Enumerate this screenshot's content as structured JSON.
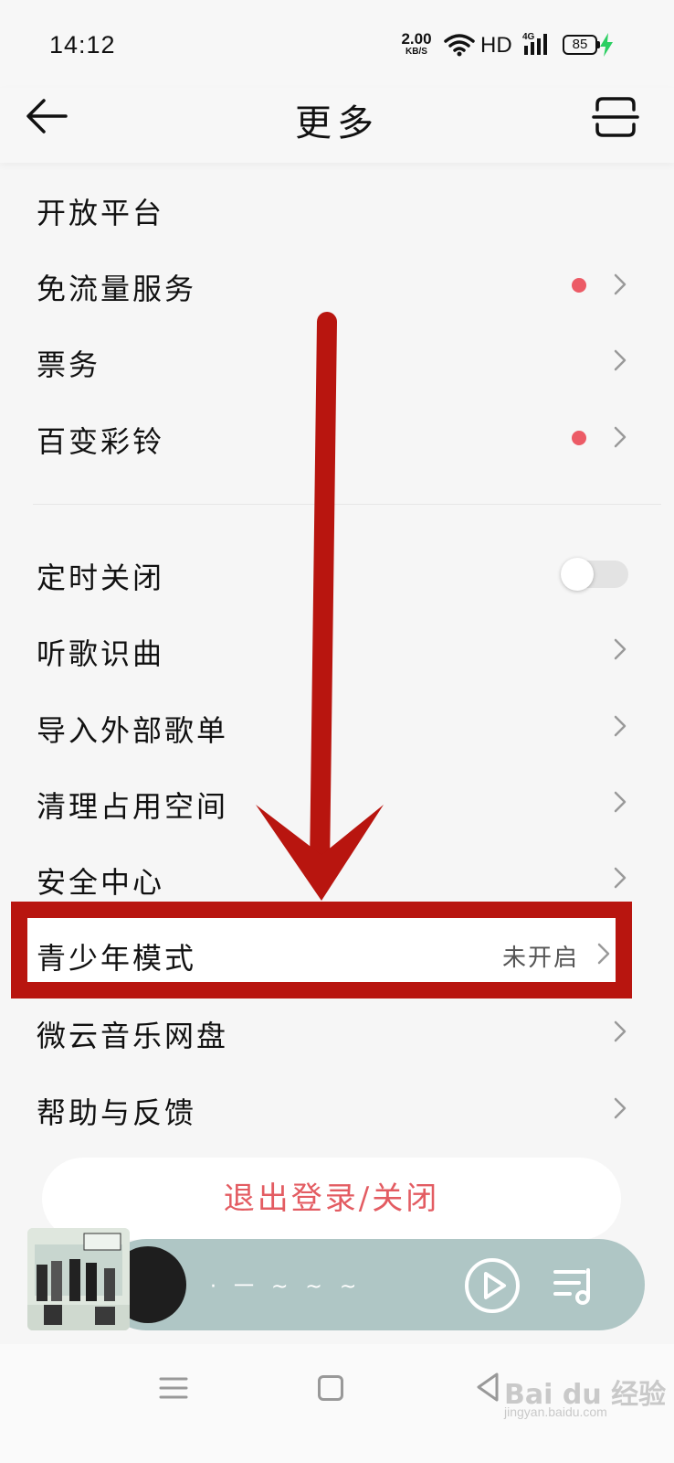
{
  "status": {
    "time": "14:12",
    "net_speed": "2.00",
    "net_unit": "KB/S",
    "hd": "HD",
    "network": "4G",
    "battery": "85"
  },
  "header": {
    "title": "更多"
  },
  "menu_group1": [
    {
      "label": "开放平台",
      "dot": false,
      "chevron": false
    },
    {
      "label": "免流量服务",
      "dot": true,
      "chevron": true
    },
    {
      "label": "票务",
      "dot": false,
      "chevron": true
    },
    {
      "label": "百变彩铃",
      "dot": true,
      "chevron": true
    }
  ],
  "menu_group2": [
    {
      "label": "定时关闭",
      "toggle": false
    },
    {
      "label": "听歌识曲"
    },
    {
      "label": "导入外部歌单"
    },
    {
      "label": "清理占用空间"
    },
    {
      "label": "安全中心"
    },
    {
      "label": "青少年模式",
      "value": "未开启"
    },
    {
      "label": "微云音乐网盘"
    },
    {
      "label": "帮助与反馈"
    }
  ],
  "logout_label": "退出登录/关闭",
  "player": {
    "song": "· 一 ~ ~ ~"
  },
  "watermark": {
    "main": "Bai du 经验",
    "sub": "jingyan.baidu.com"
  },
  "colors": {
    "accent_red": "#b8150f",
    "dot_red": "#ec5b66",
    "logout_text": "#e35c62",
    "player_bg": "#afc6c5"
  }
}
